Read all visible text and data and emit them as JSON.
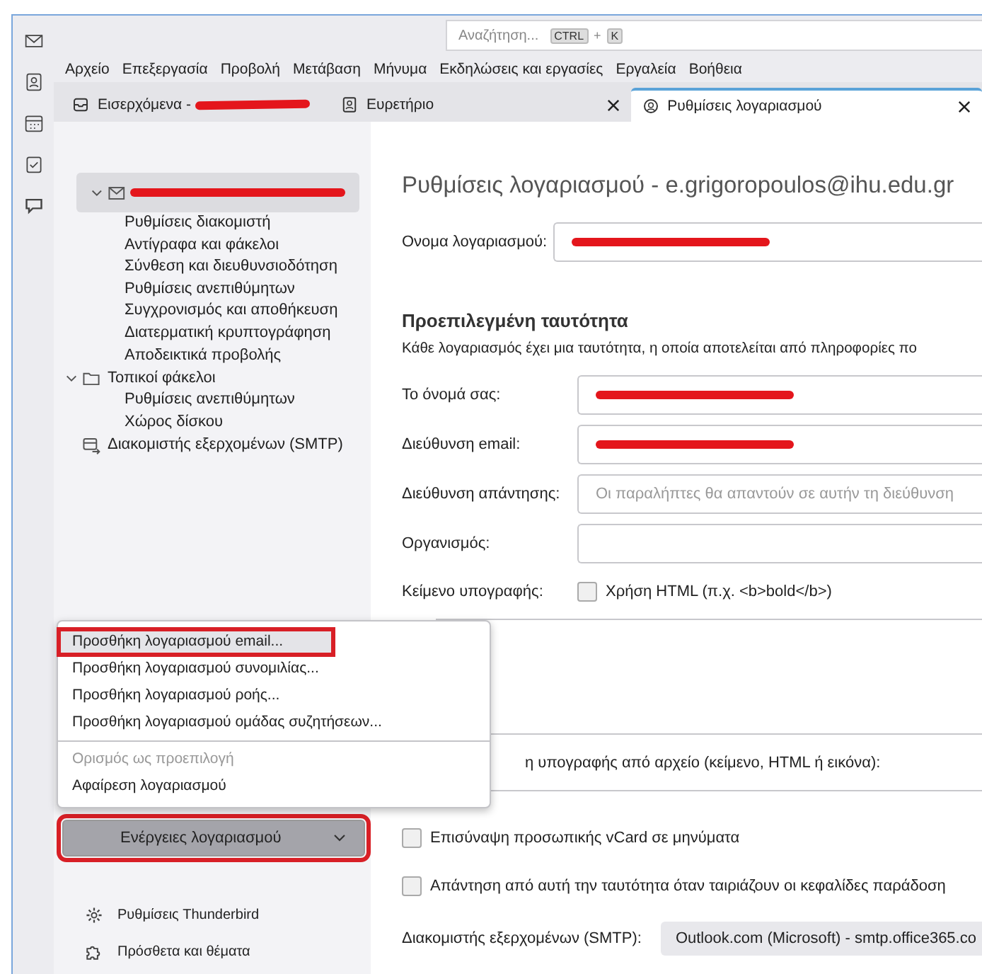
{
  "search": {
    "placeholder": "Αναζήτηση...",
    "keys": [
      "CTRL",
      "+",
      "K"
    ]
  },
  "menubar": [
    "Αρχείο",
    "Επεξεργασία",
    "Προβολή",
    "Μετάβαση",
    "Μήνυμα",
    "Εκδηλώσεις και εργασίες",
    "Εργαλεία",
    "Βοήθεια"
  ],
  "tabs": [
    {
      "kind": "inbox",
      "label": "Εισερχόμενα -",
      "redacted": true,
      "closable": false,
      "selected": false
    },
    {
      "kind": "book",
      "label": "Ευρετήριο",
      "redacted": false,
      "closable": true,
      "selected": false
    },
    {
      "kind": "account",
      "label": "Ρυθμίσεις λογαριασμού",
      "redacted": false,
      "closable": true,
      "selected": true
    }
  ],
  "tree": [
    {
      "kind": "mail",
      "redacted": true,
      "expanded": true,
      "selected": true,
      "children": [
        "Ρυθμίσεις διακομιστή",
        "Αντίγραφα και φάκελοι",
        "Σύνθεση και διευθυνσιοδότηση",
        "Ρυθμίσεις ανεπιθύμητων",
        "Συγχρονισμός και αποθήκευση",
        "Διατερματική κρυπτογράφηση",
        "Αποδεικτικά προβολής"
      ]
    },
    {
      "kind": "folder",
      "label": "Τοπικοί φάκελοι",
      "redacted": false,
      "expanded": true,
      "selected": false,
      "children": [
        "Ρυθμίσεις ανεπιθύμητων",
        "Χώρος δίσκου"
      ]
    },
    {
      "kind": "smtp",
      "label": "Διακομιστής εξερχομένων (SMTP)",
      "redacted": false,
      "expanded": false,
      "selected": false
    }
  ],
  "account_menu": [
    [
      {
        "label": "Προσθήκη λογαριασμού email...",
        "selected": true,
        "disabled": false,
        "annotated": true
      },
      {
        "label": "Προσθήκη λογαριασμού συνομιλίας...",
        "selected": false,
        "disabled": false,
        "annotated": false
      },
      {
        "label": "Προσθήκη λογαριασμού ροής...",
        "selected": false,
        "disabled": false,
        "annotated": false
      },
      {
        "label": "Προσθήκη λογαριασμού ομάδας συζητήσεων...",
        "selected": false,
        "disabled": false,
        "annotated": false
      }
    ],
    [
      {
        "label": "Ορισμός ως προεπιλογή",
        "selected": false,
        "disabled": true,
        "annotated": false
      },
      {
        "label": "Αφαίρεση λογαριασμού",
        "selected": false,
        "disabled": false,
        "annotated": false
      }
    ]
  ],
  "account_actions": {
    "label": "Ενέργειες λογαριασμού",
    "annotated": true
  },
  "footer_links": [
    {
      "kind": "gear",
      "label": "Ρυθμίσεις Thunderbird"
    },
    {
      "kind": "puzzle",
      "label": "Πρόσθετα και θέματα"
    }
  ],
  "content": {
    "title": "Ρυθμίσεις λογαριασμού - e.grigoropoulos@ihu.edu.gr",
    "account_name": {
      "label": "Ονομα λογαριασμού:",
      "redacted": true
    },
    "identity_heading": "Προεπιλεγμένη ταυτότητα",
    "identity_description": "Κάθε λογαριασμός έχει μια ταυτότητα, η οποία αποτελείται από πληροφορίες πο",
    "fields": [
      {
        "label": "Το όνομά σας:",
        "redacted": true
      },
      {
        "label": "Διεύθυνση email:",
        "redacted": true
      },
      {
        "label": "Διεύθυνση απάντησης:",
        "redacted": false,
        "placeholder": "Οι παραλήπτες θα απαντούν σε αυτήν τη διεύθυνση"
      },
      {
        "label": "Οργανισμός:",
        "redacted": false
      }
    ],
    "signature": {
      "label": "Κείμενο υπογραφής:",
      "html_option": {
        "label": "Χρήση HTML (π.χ. <b>bold</b>)",
        "checked": false
      }
    },
    "attach_signature_label": "η υπογραφής από αρχείο (κείμενο, HTML ή εικόνα):",
    "options": [
      {
        "label": "Επισύναψη προσωπικής vCard σε μηνύματα",
        "checked": false
      },
      {
        "label": "Απάντηση από αυτή την ταυτότητα όταν ταιριάζουν οι κεφαλίδες παράδοση",
        "checked": false
      }
    ],
    "smtp": {
      "label": "Διακομιστής εξερχομένων (SMTP):",
      "value": "Outlook.com (Microsoft) - smtp.office365.co"
    }
  }
}
